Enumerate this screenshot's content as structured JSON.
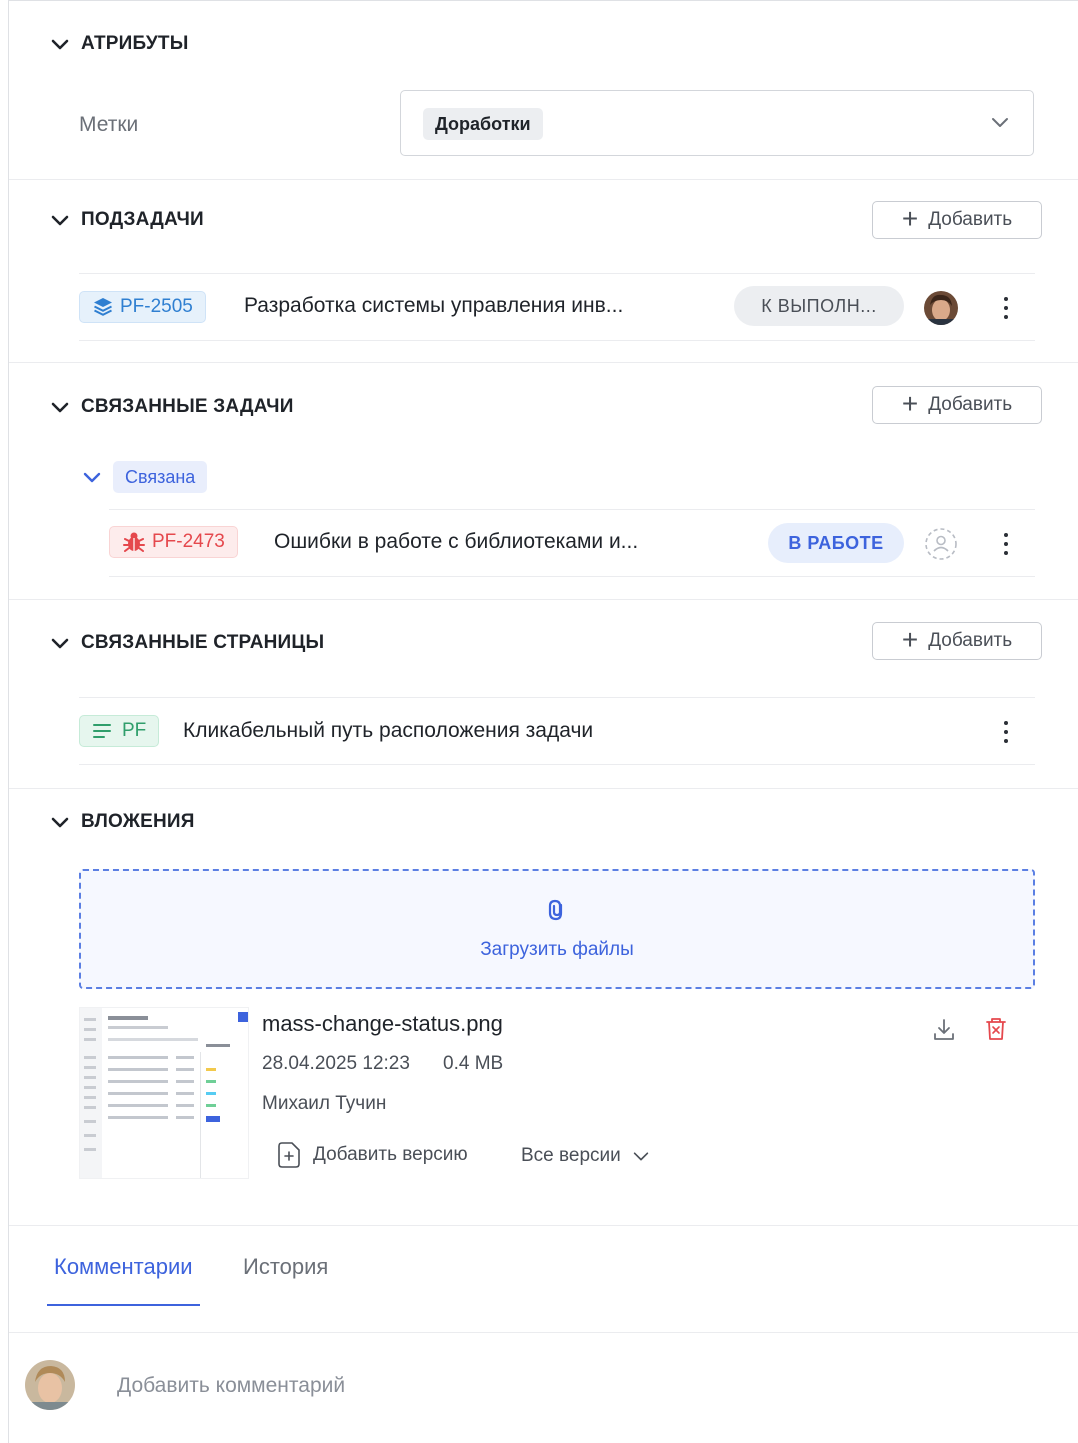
{
  "attributes": {
    "title": "АТРИБУТЫ",
    "labels_field_label": "Метки",
    "labels_value": "Доработки"
  },
  "subtasks": {
    "title": "ПОДЗАДАЧИ",
    "add_label": "Добавить",
    "items": [
      {
        "key": "PF-2505",
        "title": "Разработка системы управления инв...",
        "status": "К ВЫПОЛН..."
      }
    ]
  },
  "linked_tasks": {
    "title": "СВЯЗАННЫЕ ЗАДАЧИ",
    "add_label": "Добавить",
    "group_label": "Связана",
    "items": [
      {
        "key": "PF-2473",
        "title": "Ошибки в работе с библиотеками и...",
        "status": "В РАБОТЕ"
      }
    ]
  },
  "linked_pages": {
    "title": "СВЯЗАННЫЕ СТРАНИЦЫ",
    "add_label": "Добавить",
    "items": [
      {
        "key": "PF",
        "title": "Кликабельный путь расположения задачи"
      }
    ]
  },
  "attachments": {
    "title": "ВЛОЖЕНИЯ",
    "upload_label": "Загрузить файлы",
    "files": [
      {
        "name": "mass-change-status.png",
        "date": "28.04.2025 12:23",
        "size": "0.4 MB",
        "author": "Михаил Тучин",
        "add_version_label": "Добавить версию",
        "all_versions_label": "Все версии"
      }
    ]
  },
  "tabs": {
    "comments": "Комментарии",
    "history": "История",
    "active": "comments"
  },
  "comment": {
    "placeholder": "Добавить комментарий"
  },
  "colors": {
    "accent": "#3d63dd",
    "subtask_key": "#2f7fd1",
    "bug_key": "#e5484d",
    "page_key": "#2f9e6b",
    "delete": "#e5484d"
  }
}
